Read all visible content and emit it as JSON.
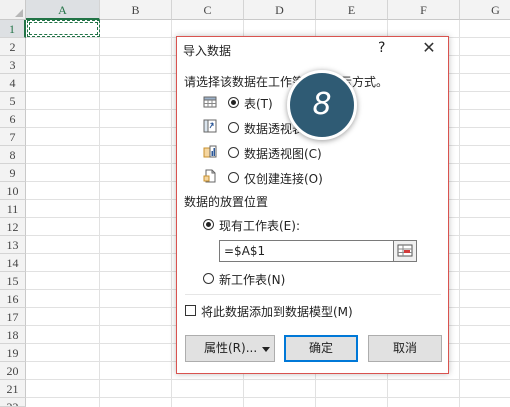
{
  "sheet": {
    "columns": [
      "A",
      "B",
      "C",
      "D",
      "E",
      "F",
      "G"
    ],
    "rows": [
      "1",
      "2",
      "3",
      "4",
      "5",
      "6",
      "7",
      "8",
      "9",
      "10",
      "11",
      "12",
      "13",
      "14",
      "15",
      "16",
      "17",
      "18",
      "19",
      "20",
      "21",
      "22"
    ]
  },
  "dialog": {
    "title": "导入数据",
    "help": "?",
    "close": "✕",
    "prompt": "请选择该数据在工作簿中的显示方式。",
    "view_options": [
      {
        "label": "表(T)",
        "selected": true,
        "icon": "table-icon"
      },
      {
        "label": "数据透视表(P)",
        "selected": false,
        "icon": "pivot-table-icon"
      },
      {
        "label": "数据透视图(C)",
        "selected": false,
        "icon": "pivot-chart-icon"
      },
      {
        "label": "仅创建连接(O)",
        "selected": false,
        "icon": "connection-only-icon"
      }
    ],
    "placement_heading": "数据的放置位置",
    "existing_sheet": "现有工作表(E):",
    "reference_value": "=$A$1",
    "new_sheet": "新工作表(N)",
    "add_to_model": "将此数据添加到数据模型(M)",
    "properties_label": "属性(R)...",
    "ok_label": "确定",
    "cancel_label": "取消"
  },
  "step_badge": "8",
  "colors": {
    "excel_green": "#217346",
    "badge": "#2f5b74",
    "dialog_border": "#d9534f",
    "primary_border": "#0078d7"
  }
}
